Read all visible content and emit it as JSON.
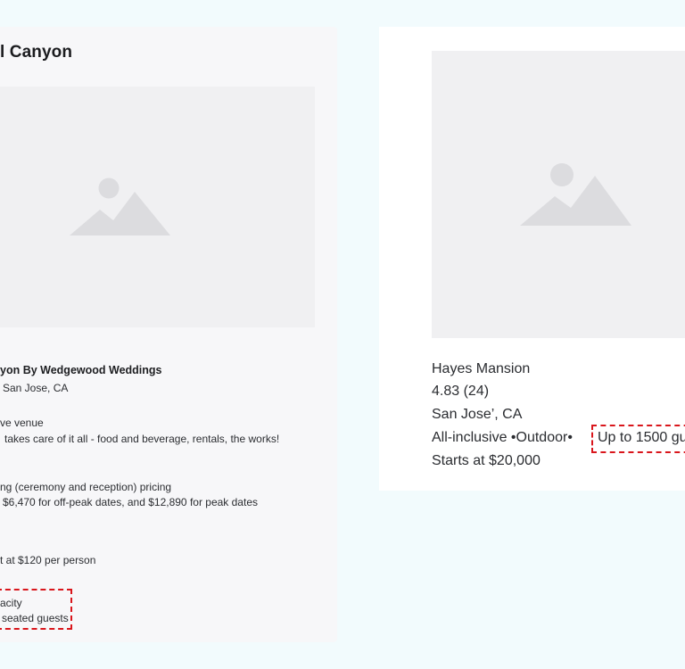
{
  "left_card": {
    "title": "l Canyon",
    "venue_name": "yon By Wedgewood Weddings",
    "location": "San Jose, CA",
    "type_line1": "ve venue",
    "type_line2": "takes care of it all - food and beverage, rentals, the works!",
    "pricing_line1": "ng (ceremony and reception) pricing",
    "pricing_line2": "$6,470 for off-peak dates, and $12,890 for peak dates",
    "per_person": "t at $120 per person",
    "capacity_label": "acity",
    "capacity_value": "seated guests"
  },
  "right_card": {
    "name": "Hayes Mansion",
    "rating": "4.83 (24)",
    "location": "San Jose’, CA",
    "tags": "All-inclusive •Outdoor•",
    "capacity": "Up to 1500 gu",
    "price": "Starts at $20,000"
  },
  "colors": {
    "background": "#f2fbfd",
    "left_card_bg": "#f7f7f9",
    "right_card_bg": "#ffffff",
    "image_placeholder_bg": "#f0f0f2",
    "image_icon": "#dcdcdf",
    "highlight_dash": "#d9161c"
  },
  "icons": {
    "left_image": "image-placeholder-icon",
    "right_image": "image-placeholder-icon"
  }
}
